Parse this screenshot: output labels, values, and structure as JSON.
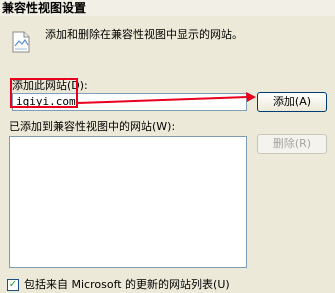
{
  "window": {
    "title": "兼容性视图设置"
  },
  "description": "添加和删除在兼容性视图中显示的网站。",
  "add_site": {
    "label": "添加此网站(D):",
    "value": "iqiyi.com",
    "button_label": "添加(A)"
  },
  "site_list": {
    "label": "已添加到兼容性视图中的网站(W):",
    "items": [],
    "remove_button_label": "删除(R)"
  },
  "microsoft_list": {
    "label": "包括来自 Microsoft 的更新的网站列表(U)",
    "checked": true
  },
  "annotation": {
    "color": "#e8001c"
  },
  "icons": {
    "document": "document-icon",
    "checkmark": "checkmark-icon"
  }
}
